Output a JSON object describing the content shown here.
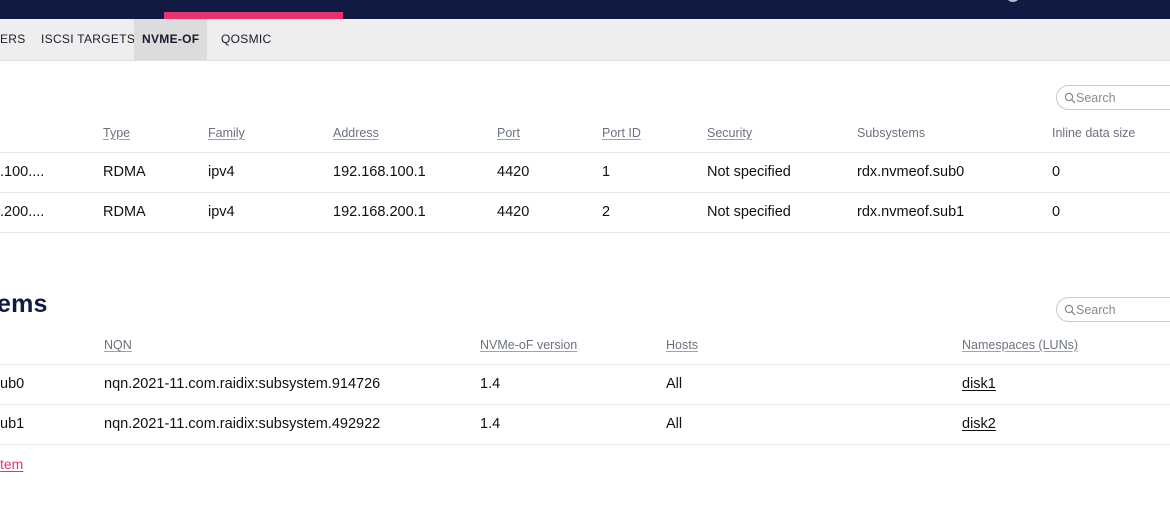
{
  "tabs": [
    {
      "label": "ERS"
    },
    {
      "label": "ISCSI TARGETS"
    },
    {
      "label": "NVME-OF"
    },
    {
      "label": "QOSMIC"
    }
  ],
  "ports": {
    "search_placeholder": "Search",
    "columns": [
      "Type",
      "Family",
      "Address",
      "Port",
      "Port ID",
      "Security",
      "Subsystems",
      "Inline data size"
    ],
    "rows": [
      {
        "name": ".100....",
        "type": "RDMA",
        "family": "ipv4",
        "address": "192.168.100.1",
        "port": "4420",
        "port_id": "1",
        "security": "Not specified",
        "subsystems": "rdx.nvmeof.sub0",
        "inline_size": "0"
      },
      {
        "name": ".200....",
        "type": "RDMA",
        "family": "ipv4",
        "address": "192.168.200.1",
        "port": "4420",
        "port_id": "2",
        "security": "Not specified",
        "subsystems": "rdx.nvmeof.sub1",
        "inline_size": "0"
      }
    ]
  },
  "subsystems": {
    "title": "ems",
    "search_placeholder": "Search",
    "columns": [
      "NQN",
      "NVMe-oF version",
      "Hosts",
      "Namespaces (LUNs)"
    ],
    "rows": [
      {
        "name": "ub0",
        "nqn": "nqn.2021-11.com.raidix:subsystem.914726",
        "version": "1.4",
        "hosts": "All",
        "namespaces": "disk1"
      },
      {
        "name": "ub1",
        "nqn": "nqn.2021-11.com.raidix:subsystem.492922",
        "version": "1.4",
        "hosts": "All",
        "namespaces": "disk2"
      }
    ],
    "add_label": "tem"
  },
  "colors": {
    "navbar": "#111a43",
    "accent": "#e8336e",
    "tabbar": "#eeeeee"
  },
  "icons": {
    "search": "magnifier-icon",
    "user": "avatar-icon"
  }
}
